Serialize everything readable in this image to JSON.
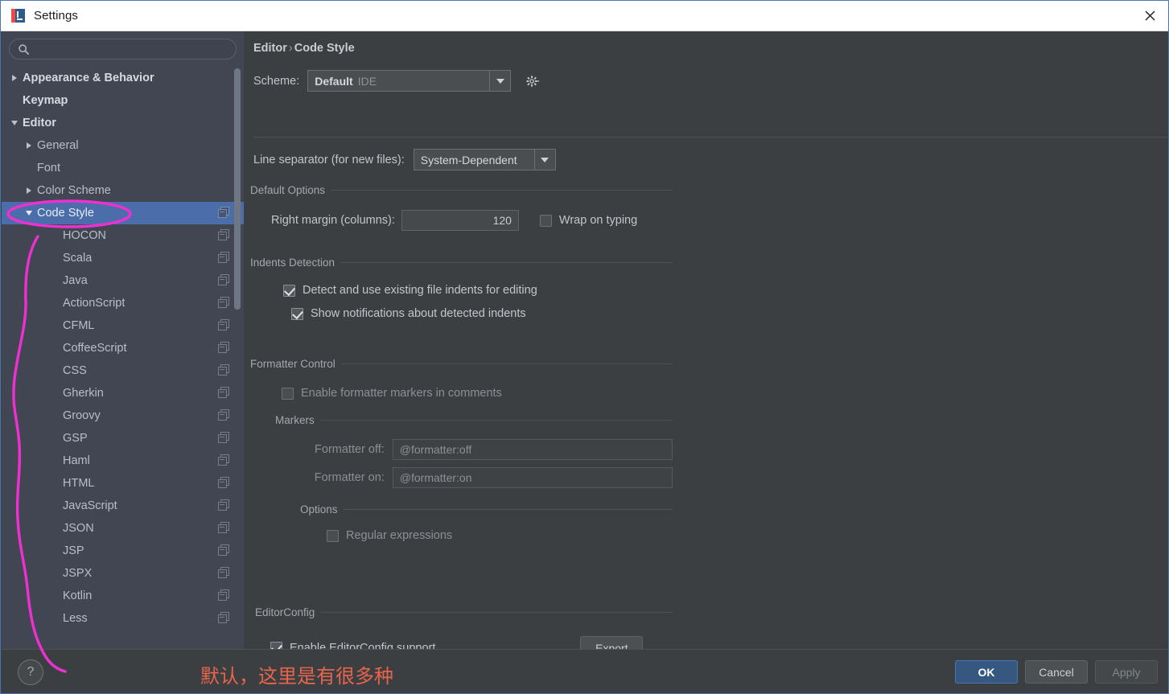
{
  "window": {
    "title": "Settings",
    "logo_icon": "intellij-idea-logo-icon",
    "close_icon": "close-icon"
  },
  "sidebar": {
    "search": {
      "value": "",
      "placeholder": "",
      "icon": "search-icon"
    },
    "items": [
      {
        "label": "Appearance & Behavior",
        "level": 0,
        "twisty": "right",
        "bold": true,
        "selected": false,
        "scheme_icon": false
      },
      {
        "label": "Keymap",
        "level": 0,
        "twisty": "none",
        "bold": true,
        "selected": false,
        "scheme_icon": false
      },
      {
        "label": "Editor",
        "level": 0,
        "twisty": "down",
        "bold": true,
        "selected": false,
        "scheme_icon": false
      },
      {
        "label": "General",
        "level": 1,
        "twisty": "right",
        "bold": false,
        "selected": false,
        "scheme_icon": false
      },
      {
        "label": "Font",
        "level": 1,
        "twisty": "none",
        "bold": false,
        "selected": false,
        "scheme_icon": false
      },
      {
        "label": "Color Scheme",
        "level": 1,
        "twisty": "right",
        "bold": false,
        "selected": false,
        "scheme_icon": false
      },
      {
        "label": "Code Style",
        "level": 1,
        "twisty": "down",
        "bold": false,
        "selected": true,
        "scheme_icon": true
      },
      {
        "label": "HOCON",
        "level": 2,
        "twisty": "none",
        "bold": false,
        "selected": false,
        "scheme_icon": true
      },
      {
        "label": "Scala",
        "level": 2,
        "twisty": "none",
        "bold": false,
        "selected": false,
        "scheme_icon": true
      },
      {
        "label": "Java",
        "level": 2,
        "twisty": "none",
        "bold": false,
        "selected": false,
        "scheme_icon": true
      },
      {
        "label": "ActionScript",
        "level": 2,
        "twisty": "none",
        "bold": false,
        "selected": false,
        "scheme_icon": true
      },
      {
        "label": "CFML",
        "level": 2,
        "twisty": "none",
        "bold": false,
        "selected": false,
        "scheme_icon": true
      },
      {
        "label": "CoffeeScript",
        "level": 2,
        "twisty": "none",
        "bold": false,
        "selected": false,
        "scheme_icon": true
      },
      {
        "label": "CSS",
        "level": 2,
        "twisty": "none",
        "bold": false,
        "selected": false,
        "scheme_icon": true
      },
      {
        "label": "Gherkin",
        "level": 2,
        "twisty": "none",
        "bold": false,
        "selected": false,
        "scheme_icon": true
      },
      {
        "label": "Groovy",
        "level": 2,
        "twisty": "none",
        "bold": false,
        "selected": false,
        "scheme_icon": true
      },
      {
        "label": "GSP",
        "level": 2,
        "twisty": "none",
        "bold": false,
        "selected": false,
        "scheme_icon": true
      },
      {
        "label": "Haml",
        "level": 2,
        "twisty": "none",
        "bold": false,
        "selected": false,
        "scheme_icon": true
      },
      {
        "label": "HTML",
        "level": 2,
        "twisty": "none",
        "bold": false,
        "selected": false,
        "scheme_icon": true
      },
      {
        "label": "JavaScript",
        "level": 2,
        "twisty": "none",
        "bold": false,
        "selected": false,
        "scheme_icon": true
      },
      {
        "label": "JSON",
        "level": 2,
        "twisty": "none",
        "bold": false,
        "selected": false,
        "scheme_icon": true
      },
      {
        "label": "JSP",
        "level": 2,
        "twisty": "none",
        "bold": false,
        "selected": false,
        "scheme_icon": true
      },
      {
        "label": "JSPX",
        "level": 2,
        "twisty": "none",
        "bold": false,
        "selected": false,
        "scheme_icon": true
      },
      {
        "label": "Kotlin",
        "level": 2,
        "twisty": "none",
        "bold": false,
        "selected": false,
        "scheme_icon": true
      },
      {
        "label": "Less",
        "level": 2,
        "twisty": "none",
        "bold": false,
        "selected": false,
        "scheme_icon": true
      }
    ]
  },
  "main": {
    "breadcrumb": {
      "parent": "Editor",
      "separator": "›",
      "current": "Code Style"
    },
    "scheme": {
      "label": "Scheme:",
      "value": "Default",
      "value_suffix": "IDE",
      "dropdown_icon": "chevron-down-icon",
      "gear_icon": "gear-icon"
    },
    "line_separator": {
      "label": "Line separator (for new files):",
      "value": "System-Dependent",
      "dropdown_icon": "chevron-down-icon"
    },
    "default_options": {
      "title": "Default Options",
      "right_margin_label": "Right margin (columns):",
      "right_margin_value": "120",
      "wrap_on_typing_label": "Wrap on typing",
      "wrap_on_typing_checked": false
    },
    "indents_detection": {
      "title": "Indents Detection",
      "detect_label": "Detect and use existing file indents for editing",
      "detect_checked": true,
      "notify_label": "Show notifications about detected indents",
      "notify_checked": true
    },
    "formatter_control": {
      "title": "Formatter Control",
      "enable_label": "Enable formatter markers in comments",
      "enable_checked": false,
      "markers_title": "Markers",
      "formatter_off_label": "Formatter off:",
      "formatter_off_value": "@formatter:off",
      "formatter_on_label": "Formatter on:",
      "formatter_on_value": "@formatter:on",
      "options_title": "Options",
      "regex_label": "Regular expressions",
      "regex_checked": false
    },
    "editorconfig": {
      "title": "EditorConfig",
      "enable_label": "Enable EditorConfig support",
      "enable_checked": true,
      "export_label": "Export"
    }
  },
  "bottom": {
    "help_icon": "help-question-icon",
    "annotation": "默认，这里是有很多种",
    "annotation_color": "#e8644b",
    "ok_label": "OK",
    "cancel_label": "Cancel",
    "apply_label": "Apply",
    "apply_disabled": true
  },
  "annotations": {
    "ink_color": "#ee30d0",
    "shapes": [
      "ellipse-around-code-style",
      "curved-line-to-help-button"
    ]
  }
}
